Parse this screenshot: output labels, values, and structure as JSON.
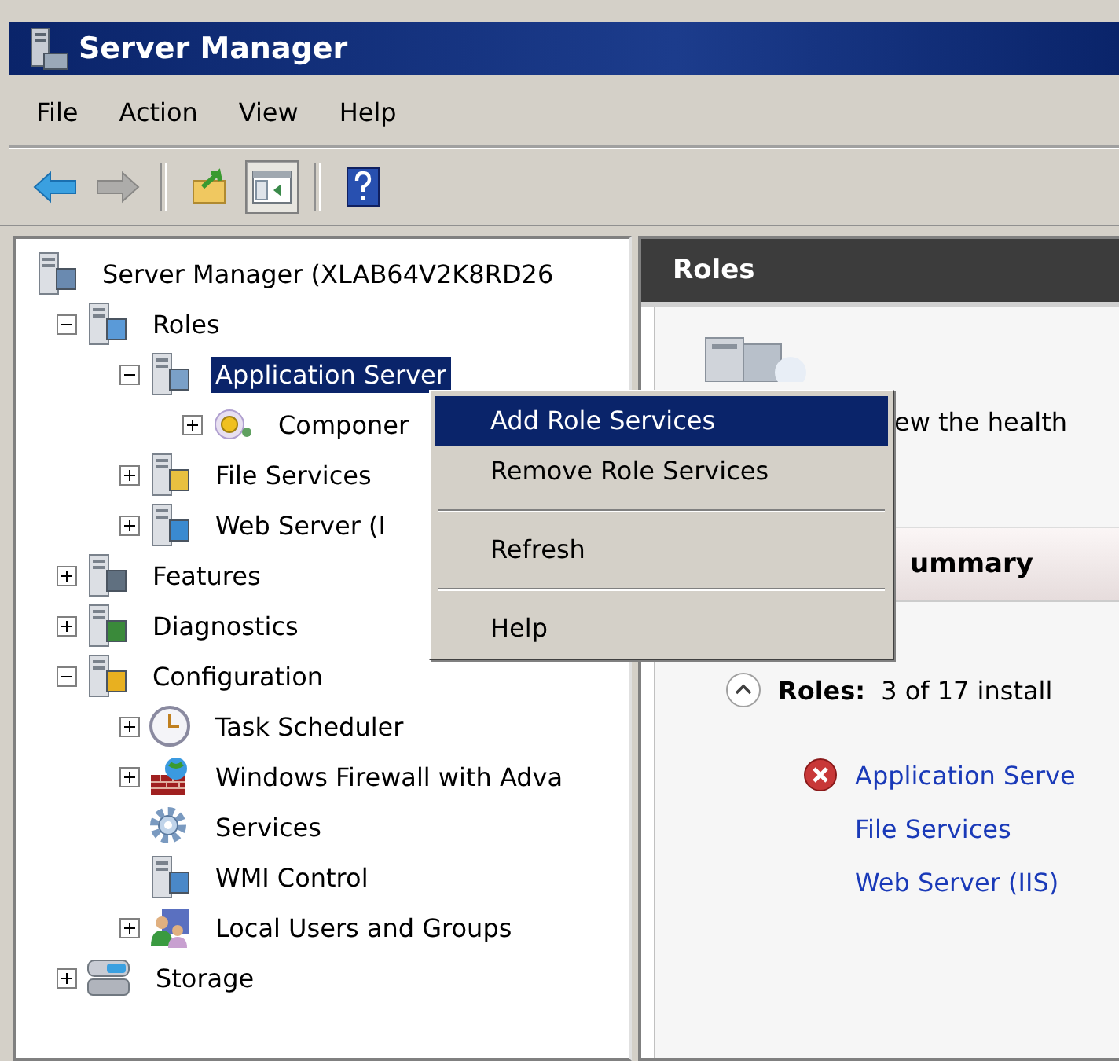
{
  "window": {
    "title": "Server Manager"
  },
  "menu": [
    "File",
    "Action",
    "View",
    "Help"
  ],
  "toolbar": [
    {
      "disabled": false,
      "pressed": false
    },
    {
      "disabled": true,
      "pressed": false
    },
    {
      "disabled": false,
      "pressed": false
    },
    {
      "disabled": false,
      "pressed": true
    },
    {
      "disabled": false,
      "pressed": false
    }
  ],
  "tree": {
    "label": "Server Manager (XLAB64V2K8RD26",
    "selected": false,
    "children": [
      {
        "label": "Roles",
        "selected": false,
        "expanded": true,
        "children": [
          {
            "label": "Application Server",
            "selected": true,
            "expanded": true,
            "children": [
              {
                "label": "Componer",
                "selected": false,
                "expanded": false
              }
            ]
          },
          {
            "label": "File Services",
            "selected": false,
            "expanded": false
          },
          {
            "label": "Web Server (I",
            "selected": false,
            "expanded": false
          }
        ]
      },
      {
        "label": "Features",
        "selected": false,
        "expanded": false
      },
      {
        "label": "Diagnostics",
        "selected": false,
        "expanded": false
      },
      {
        "label": "Configuration",
        "selected": false,
        "expanded": true,
        "children": [
          {
            "label": "Task Scheduler",
            "selected": false,
            "expanded": false
          },
          {
            "label": "Windows Firewall with Adva",
            "selected": false,
            "expanded": false
          },
          {
            "label": "Services",
            "selected": false
          },
          {
            "label": "WMI Control",
            "selected": false
          },
          {
            "label": "Local Users and Groups",
            "selected": false,
            "expanded": false
          }
        ]
      },
      {
        "label": "Storage",
        "selected": false,
        "expanded": false
      }
    ]
  },
  "details": {
    "header": "Roles",
    "description": "ew the health",
    "summary_header": "ummary",
    "roles_label": "Roles:",
    "roles_value": "3 of 17 install",
    "links": [
      {
        "label": "Application Serve",
        "error": true
      },
      {
        "label": "File Services",
        "error": false
      },
      {
        "label": "Web Server (IIS)",
        "error": false
      }
    ]
  },
  "context_menu": [
    {
      "kind": "item",
      "label": "Add Role Services",
      "selected": true
    },
    {
      "kind": "item",
      "label": "Remove Role Services",
      "selected": false
    },
    {
      "kind": "separator"
    },
    {
      "kind": "item",
      "label": "Refresh",
      "selected": false
    },
    {
      "kind": "separator"
    },
    {
      "kind": "item",
      "label": "Help",
      "selected": false
    }
  ]
}
